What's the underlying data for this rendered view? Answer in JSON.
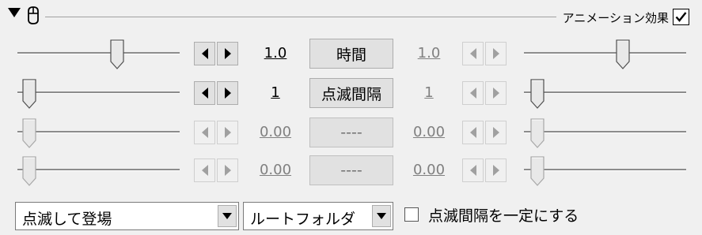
{
  "header": {
    "effect_label": "アニメーション効果",
    "effect_checked": true,
    "collapse_icon": "triangle-down-icon",
    "mouse_icon": "mouse-icon"
  },
  "rows": [
    {
      "start_value": "1.0",
      "label": "時間",
      "end_value": "1.0",
      "enabled": true,
      "start_level": 0.6,
      "end_level": 0.6
    },
    {
      "start_value": "1",
      "label": "点滅間隔",
      "end_value": "1",
      "enabled": true,
      "start_level": 0.0,
      "end_level": 0.0
    },
    {
      "start_value": "0.00",
      "label": "----",
      "end_value": "0.00",
      "enabled": false,
      "start_level": 0.0,
      "end_level": 0.0
    },
    {
      "start_value": "0.00",
      "label": "----",
      "end_value": "0.00",
      "enabled": false,
      "start_level": 0.0,
      "end_level": 0.0
    }
  ],
  "footer": {
    "effect_select": "点滅して登場",
    "folder_select": "ルートフォルダ",
    "constant_interval_label": "点滅間隔を一定にする",
    "constant_interval_checked": false
  }
}
